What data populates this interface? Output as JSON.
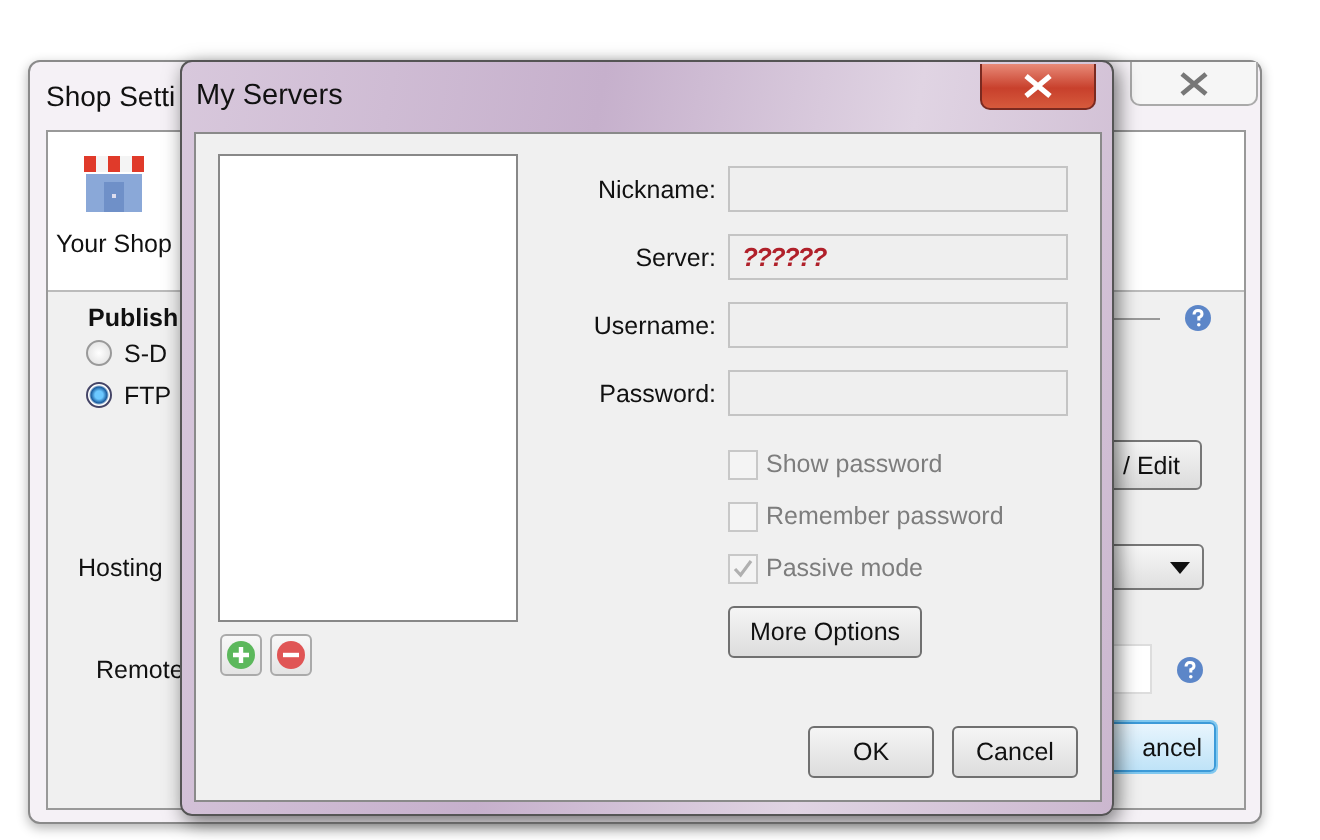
{
  "background_window": {
    "title": "Shop Setti",
    "shop_label": "Your Shop",
    "section_heading": "Publish",
    "publish_options": [
      {
        "label": "S-D",
        "selected": false
      },
      {
        "label": "FTP",
        "selected": true
      }
    ],
    "edit_button": "/ Edit",
    "hosting_label": "Hosting",
    "remote_label": "Remote",
    "cancel_button": {
      "label": "ancel",
      "focused": true
    }
  },
  "dialog": {
    "title": "My Servers",
    "fields": [
      {
        "label": "Nickname:"
      },
      {
        "label": "Server:",
        "value": "??????"
      },
      {
        "label": "Username:"
      },
      {
        "label": "Password:"
      }
    ],
    "checkboxes": [
      {
        "label": "Show password",
        "checked": false,
        "disabled": true
      },
      {
        "label": "Remember password",
        "checked": false,
        "disabled": true
      },
      {
        "label": "Passive mode",
        "checked": true,
        "disabled": true
      }
    ],
    "more_button": "More Options",
    "buttons": [
      "OK",
      "Cancel"
    ]
  }
}
